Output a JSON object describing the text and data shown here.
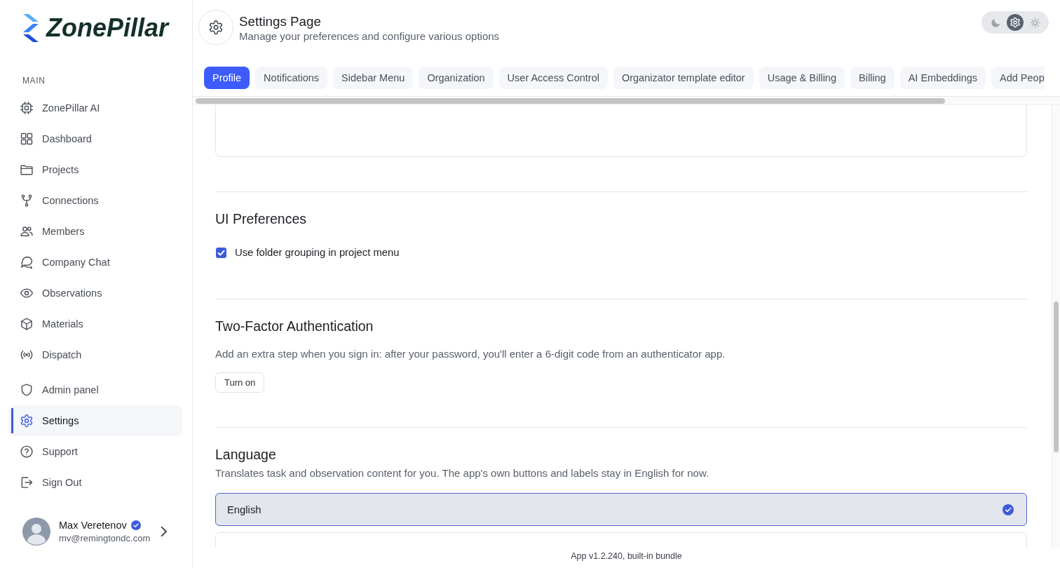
{
  "sidebar": {
    "logo": "ZonePillar",
    "sections": [
      {
        "label": "MAIN",
        "items": [
          {
            "label": "ZonePillar AI",
            "selected": false
          },
          {
            "label": "Dashboard",
            "selected": false
          },
          {
            "label": "Projects",
            "selected": false
          },
          {
            "label": "Connections",
            "selected": false
          },
          {
            "label": "Members",
            "selected": false
          },
          {
            "label": "Company Chat",
            "selected": false
          },
          {
            "label": "Observations",
            "selected": false
          },
          {
            "label": "Materials",
            "selected": false
          },
          {
            "label": "Dispatch",
            "selected": false
          }
        ]
      },
      {
        "items": [
          {
            "label": "Admin panel",
            "selected": false
          },
          {
            "label": "Settings",
            "selected": true
          },
          {
            "label": "Support",
            "selected": false
          },
          {
            "label": "Sign Out",
            "selected": false
          }
        ]
      }
    ],
    "user": {
      "name": "Max Veretenov",
      "email": "mv@remingtondc.com",
      "verified": true
    }
  },
  "header": {
    "title": "Settings Page",
    "subtitle": "Manage your preferences and configure various options"
  },
  "theme_switch": {
    "options": [
      {
        "kind": "dark",
        "selected": false
      },
      {
        "kind": "system",
        "selected": true
      },
      {
        "kind": "light",
        "selected": false
      }
    ]
  },
  "tabs": [
    {
      "label": "Profile",
      "selected": true
    },
    {
      "label": "Notifications",
      "selected": false
    },
    {
      "label": "Sidebar Menu",
      "selected": false
    },
    {
      "label": "Organization",
      "selected": false
    },
    {
      "label": "User Access Control",
      "selected": false
    },
    {
      "label": "Organizator template editor",
      "selected": false
    },
    {
      "label": "Usage & Billing",
      "selected": false
    },
    {
      "label": "Billing",
      "selected": false
    },
    {
      "label": "AI Embeddings",
      "selected": false
    },
    {
      "label": "Add Peop",
      "selected": false
    }
  ],
  "ui_preferences": {
    "title": "UI Preferences",
    "options": [
      {
        "label": "Use folder grouping in project menu",
        "checked": true
      }
    ]
  },
  "two_factor": {
    "title": "Two-Factor Authentication",
    "description": "Add an extra step when you sign in: after your password, you'll enter a 6-digit code from an authenticator app.",
    "button": "Turn on"
  },
  "language": {
    "title": "Language",
    "description": "Translates task and observation content for you. The app's own buttons and labels stay in English for now.",
    "options": [
      {
        "label": "English",
        "selected": true
      },
      {
        "selected": false
      }
    ]
  },
  "footer": {
    "text": "App v1.2.240, built-in bundle"
  }
}
